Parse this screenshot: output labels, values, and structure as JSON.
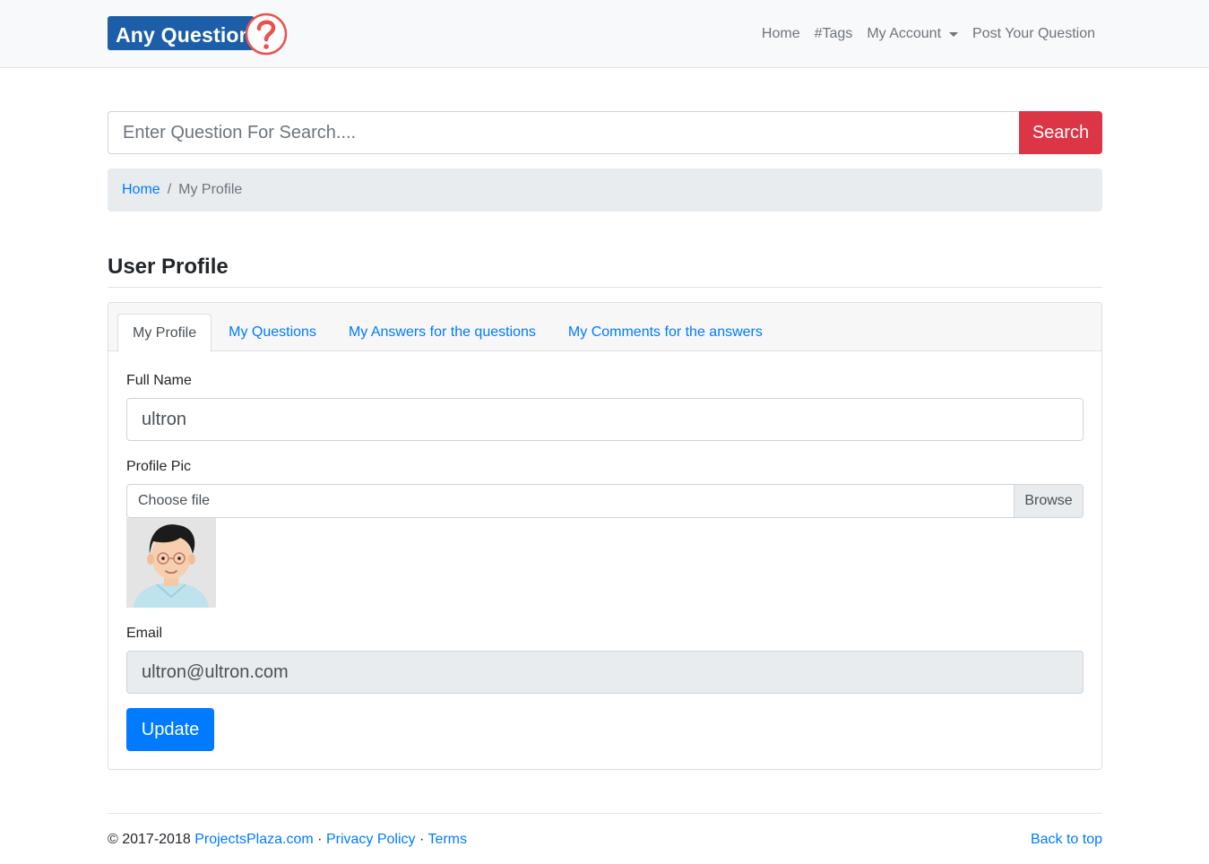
{
  "brand": {
    "name": "Any Question",
    "mark": "?"
  },
  "nav": {
    "home": "Home",
    "tags": "#Tags",
    "account": "My Account",
    "post": "Post Your Question"
  },
  "search": {
    "placeholder": "Enter Question For Search....",
    "button": "Search"
  },
  "breadcrumb": {
    "home": "Home",
    "separator": "/",
    "current": "My Profile"
  },
  "page": {
    "title": "User Profile"
  },
  "tabs": [
    {
      "label": "My Profile",
      "active": true
    },
    {
      "label": "My Questions",
      "active": false
    },
    {
      "label": "My Answers for the questions",
      "active": false
    },
    {
      "label": "My Comments for the answers",
      "active": false
    }
  ],
  "form": {
    "full_name_label": "Full Name",
    "full_name_value": "ultron",
    "profile_pic_label": "Profile Pic",
    "file_placeholder": "Choose file",
    "browse_label": "Browse",
    "email_label": "Email",
    "email_value": "ultron@ultron.com",
    "update_label": "Update"
  },
  "footer": {
    "copyright": "© 2017-2018",
    "site_link": "ProjectsPlaza.com",
    "dot1": "·",
    "privacy": "Privacy Policy",
    "dot2": "·",
    "terms": "Terms",
    "back_to_top": "Back to top"
  },
  "colors": {
    "brand": "#1c5fa8",
    "brand_mark": "#e8534f",
    "search_button": "#dc3545",
    "link": "#007bff",
    "update_button": "#007bff"
  },
  "icons": {
    "dropdown": "caret-down-icon",
    "brand_mark": "question-mark-icon"
  }
}
